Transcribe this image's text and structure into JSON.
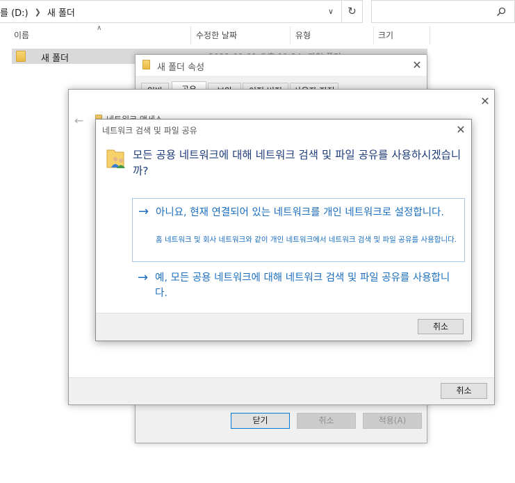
{
  "explorer": {
    "breadcrumb": [
      "를 (D:)",
      "새 폴더"
    ],
    "columns": {
      "name": "이름",
      "date": "수정한 날짜",
      "type": "유형",
      "size": "크기"
    },
    "files": [
      {
        "name": "새 폴더",
        "date": "2022-09-01 오후 11:24",
        "type": "파일 폴더"
      }
    ]
  },
  "properties_window": {
    "title": "새 폴더 속성",
    "tabs": [
      "일반",
      "공유",
      "보안",
      "이전 버전",
      "사용자 지정"
    ],
    "active_tab": "공유",
    "buttons": {
      "close": "닫기",
      "cancel": "취소",
      "apply": "적용(A)"
    }
  },
  "sharing_dialog": {
    "header_text": "네트워크 액세스",
    "cancel": "취소"
  },
  "network_dialog": {
    "title": "네트워크 검색 및 파일 공유",
    "question": "모든 공용 네트워크에 대해 네트워크 검색 및 파일 공유를 사용하시겠습니까?",
    "option_no": {
      "main": "아니요, 현재 연결되어 있는 네트워크를 개인 네트워크로 설정합니다.",
      "sub": "홈 네트워크 및 회사 네트워크와 같이 개인 네트워크에서 네트워크 검색 및 파일 공유를 사용합니다."
    },
    "option_yes": {
      "main": "예, 모든 공용 네트워크에 대해 네트워크 검색 및 파일 공유를 사용합니다."
    },
    "cancel": "취소"
  },
  "colors": {
    "link_blue": "#1c6fbf",
    "heading_blue": "#1f3d7a",
    "dialog_bg": "#f0f0f0"
  }
}
